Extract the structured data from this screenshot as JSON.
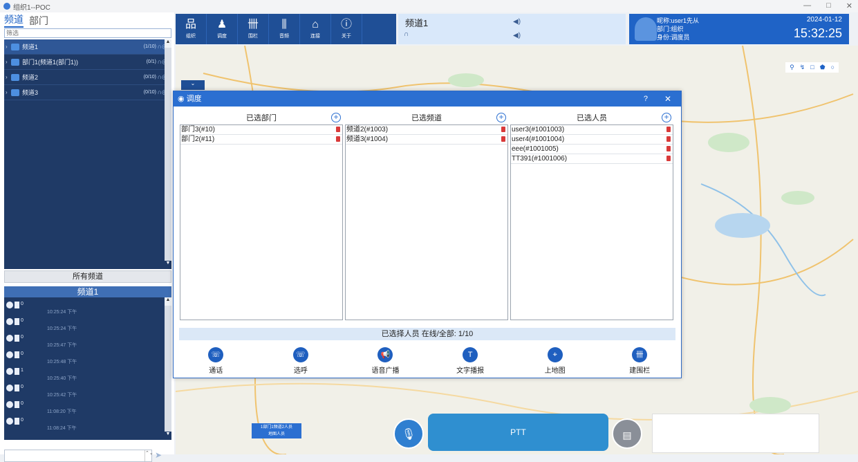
{
  "window": {
    "title": "组织1--POC",
    "min": "—",
    "max": "□",
    "close": "✕"
  },
  "tabs": [
    "频道",
    "部门"
  ],
  "filter": {
    "placeholder": "筛选"
  },
  "channels": [
    {
      "name": "频道1",
      "count": "(1/10)"
    },
    {
      "name": "部门1(频道1(部门1))",
      "count": "(0/1)"
    },
    {
      "name": "频道2",
      "count": "(0/10)"
    },
    {
      "name": "频道3",
      "count": "(0/10)"
    }
  ],
  "all_channels": "所有频道",
  "member_panel": {
    "title": "频道1"
  },
  "members": [
    {
      "stat": "0",
      "time": "10:25:24 下午"
    },
    {
      "stat": "0",
      "time": "10:25:24 下午"
    },
    {
      "stat": "0",
      "time": "10:25:47 下午"
    },
    {
      "stat": "0",
      "time": "10:25:48 下午"
    },
    {
      "stat": "1",
      "time": "10:25:40 下午"
    },
    {
      "stat": "0",
      "time": "10:25:42 下午"
    },
    {
      "stat": "0",
      "time": "11:08:20 下午"
    },
    {
      "stat": "0",
      "time": "11:08:24 下午"
    }
  ],
  "toolbar": [
    {
      "icon": "org-icon",
      "glyph": "品",
      "label": "组织"
    },
    {
      "icon": "dispatch-icon",
      "glyph": "♟",
      "label": "调度"
    },
    {
      "icon": "fence-icon",
      "glyph": "卌",
      "label": "围栏"
    },
    {
      "icon": "audio-icon",
      "glyph": "⫼",
      "label": "音频"
    },
    {
      "icon": "connect-icon",
      "glyph": "⌂",
      "label": "连接"
    },
    {
      "icon": "about-icon",
      "glyph": "ⓘ",
      "label": "关于"
    }
  ],
  "current_channel": {
    "name": "频道1"
  },
  "user": {
    "nickname": "昵称:user1先从",
    "dept": "部门:组织",
    "role": "身份:调度员",
    "date": "2024-01-12",
    "time": "15:32:25"
  },
  "dialog": {
    "title": "调度",
    "help": "?",
    "close": "✕",
    "columns": [
      {
        "header": "已选部门",
        "items": [
          "部门3(#10)",
          "部门2(#11)"
        ]
      },
      {
        "header": "已选频道",
        "items": [
          "频道2(#1003)",
          "频道3(#1004)"
        ]
      },
      {
        "header": "已选人员",
        "items": [
          "user3(#1001003)",
          "user4(#1001004)",
          "eee(#1001005)",
          "TT391(#1001006)"
        ]
      }
    ],
    "status": "已选择人员 在线/全部: 1/10",
    "actions": [
      "通话",
      "选呼",
      "语音广播",
      "文字播报",
      "上地图",
      "建围栏"
    ]
  },
  "ptt": {
    "label": "PTT"
  },
  "map_badge": {
    "line1": "1部门1频道2人员",
    "line2": "地图人员"
  },
  "colors": {
    "primary": "#1f63c6",
    "dark": "#1f3a66",
    "toolbar": "#1f4f96"
  }
}
